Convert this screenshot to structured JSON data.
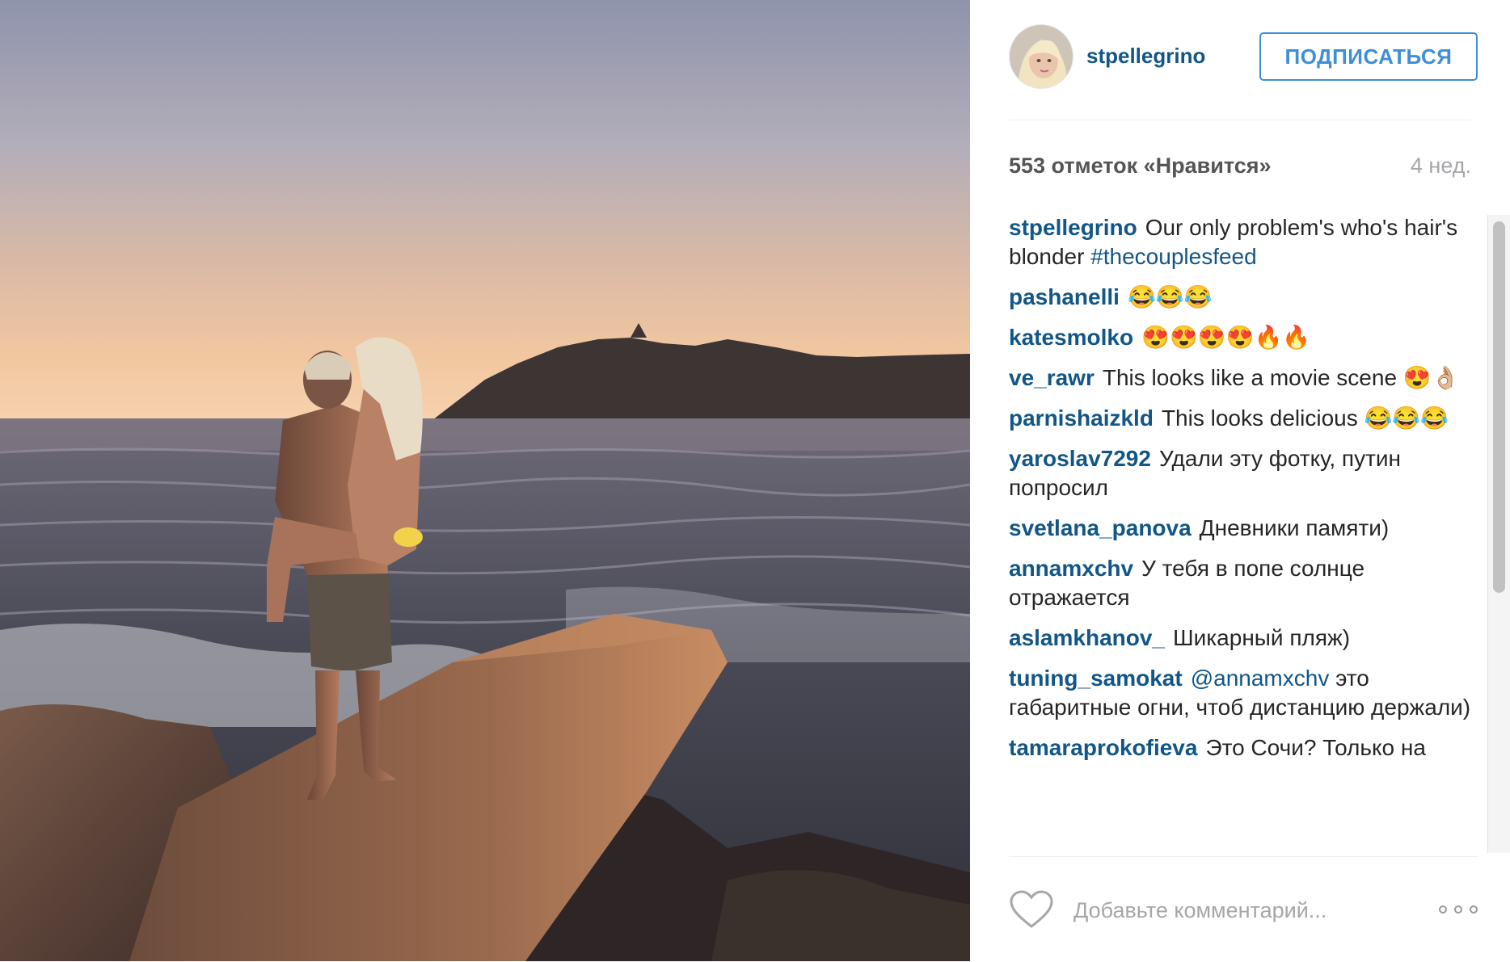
{
  "post": {
    "author": "stpellegrino",
    "follow_label": "ПОДПИСАТЬСЯ",
    "likes": "553 отметок «Нравится»",
    "time_ago": "4 нед."
  },
  "caption": {
    "user": "stpellegrino",
    "text": "Our only problem's who's hair's blonder",
    "hashtag": "#thecouplesfeed"
  },
  "comments": [
    {
      "user": "pashanelli",
      "text": "😂😂😂"
    },
    {
      "user": "katesmolko",
      "text": "😍😍😍😍🔥🔥"
    },
    {
      "user": "ve_rawr",
      "text": "This looks like a movie scene 😍👌🏼"
    },
    {
      "user": "parnishaizkld",
      "text": "This looks delicious 😂😂😂"
    },
    {
      "user": "yaroslav7292",
      "text": "Удали эту фотку, путин попросил"
    },
    {
      "user": "svetlana_panova",
      "text": "Дневники памяти)"
    },
    {
      "user": "annamxchv",
      "text": "У тебя в попе солнце отражается"
    },
    {
      "user": "aslamkhanov_",
      "text": "Шикарный пляж)"
    },
    {
      "user": "tuning_samokat",
      "mention": "@annamxchv",
      "text": "это габаритные огни, чтоб дистанцию держали)"
    },
    {
      "user": "tamaraprokofieva",
      "text": "Это Сочи? Только на"
    }
  ],
  "comment_box": {
    "placeholder": "Добавьте комментарий..."
  },
  "colors": {
    "username": "#125688",
    "follow_accent": "#3f8ed8",
    "muted": "#a5a7aa"
  },
  "icons": [
    "heart-icon",
    "more-options-icon"
  ]
}
